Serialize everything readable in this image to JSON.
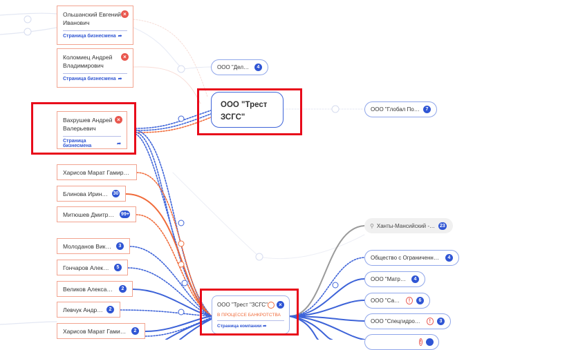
{
  "persons": [
    {
      "name": "Ольшанский Евгений Иванович",
      "link": "Страница бизнесмена"
    },
    {
      "name": "Коломиец Андрей Владимирович",
      "link": "Страница бизнесмена"
    },
    {
      "name": "Вахрушев Андрей Валерьевич",
      "link": "Страница бизнесмена"
    }
  ],
  "small_persons": [
    {
      "name": "Харисов Марат Гамирович",
      "badge": ""
    },
    {
      "name": "Блинова Ирина…",
      "badge": "30"
    },
    {
      "name": "Митюшев Дмитрий…",
      "badge": "99+"
    },
    {
      "name": "Молоданов Виктор…",
      "badge": "3"
    },
    {
      "name": "Гончаров Алексей…",
      "badge": "5"
    },
    {
      "name": "Великов Александр…",
      "badge": "2"
    },
    {
      "name": "Левчук Андрей…",
      "badge": "2"
    },
    {
      "name": "Харисов Марат Гамирович",
      "badge": "2"
    }
  ],
  "main_node": {
    "title": "ООО \"Трест ЗСГС\""
  },
  "companies_top": [
    {
      "name": "ООО \"Делкон\"",
      "badge": "4"
    },
    {
      "name": "ООО \"Глобал Порт…",
      "badge": "7"
    }
  ],
  "company_node": {
    "name": "ООО \"Трест \"ЗСГС\"",
    "status": "В ПРОЦЕССЕ БАНКРОТСТВА",
    "link": "Страница компании"
  },
  "region": {
    "name": "Ханты-Мансийский -…",
    "badge": "23"
  },
  "companies_right": [
    {
      "name": "Общество с Ограниченной…",
      "badge": "4",
      "warn": false
    },
    {
      "name": "ООО \"Матрица\"",
      "badge": "4",
      "warn": false
    },
    {
      "name": "ООО \"Сайма\"",
      "badge": "6",
      "warn": true
    },
    {
      "name": "ООО \"Спецгидродор\"",
      "badge": "3",
      "warn": true
    }
  ],
  "icons": {
    "close": "close-icon",
    "share": "share-arrow-icon",
    "warn": "warning-icon",
    "pin": "map-pin-icon",
    "clock": "clock-icon"
  },
  "colors": {
    "accent": "#2f55d4",
    "person_border": "#f2a38f",
    "highlight": "#e8091a",
    "danger": "#e9574e"
  }
}
